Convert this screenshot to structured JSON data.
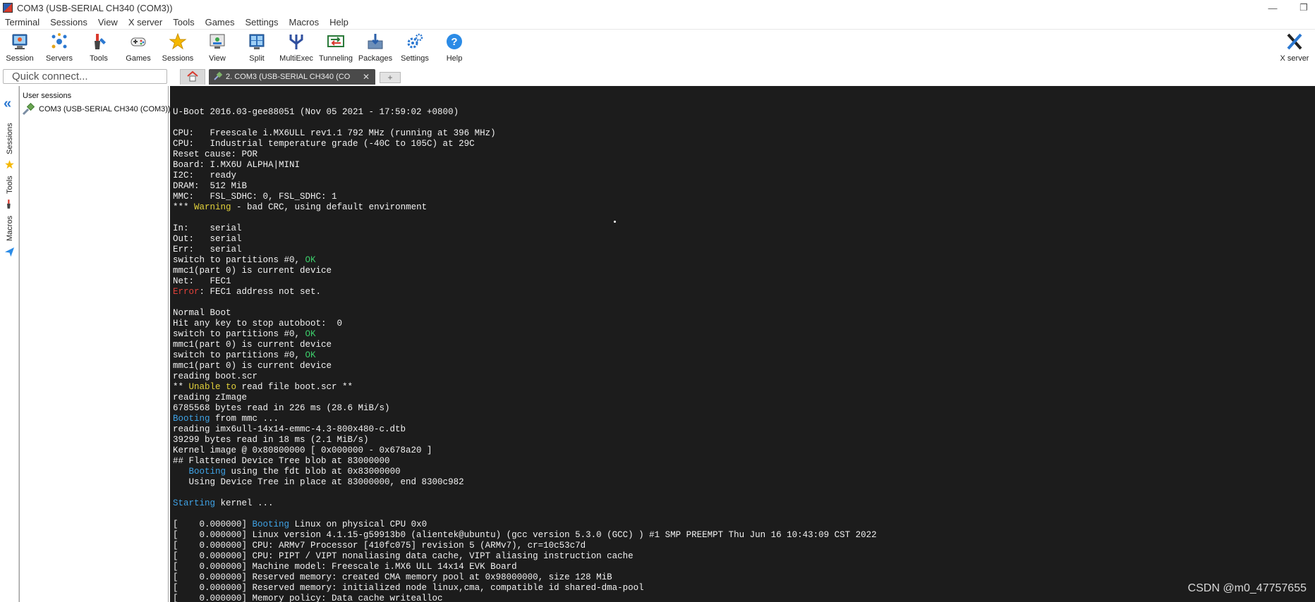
{
  "window": {
    "title": "COM3  (USB-SERIAL CH340 (COM3))",
    "minimize_glyph": "—",
    "restore_glyph": "❐"
  },
  "menu": [
    "Terminal",
    "Sessions",
    "View",
    "X server",
    "Tools",
    "Games",
    "Settings",
    "Macros",
    "Help"
  ],
  "toolbar": {
    "items": [
      {
        "label": "Session",
        "icon": "session-icon"
      },
      {
        "label": "Servers",
        "icon": "servers-icon"
      },
      {
        "label": "Tools",
        "icon": "tools-icon"
      },
      {
        "label": "Games",
        "icon": "games-icon"
      },
      {
        "label": "Sessions",
        "icon": "star-icon"
      },
      {
        "label": "View",
        "icon": "view-icon"
      },
      {
        "label": "Split",
        "icon": "split-icon"
      },
      {
        "label": "MultiExec",
        "icon": "multiexec-icon"
      },
      {
        "label": "Tunneling",
        "icon": "tunneling-icon"
      },
      {
        "label": "Packages",
        "icon": "packages-icon"
      },
      {
        "label": "Settings",
        "icon": "settings-icon"
      },
      {
        "label": "Help",
        "icon": "help-icon"
      }
    ],
    "xserver_label": "X server"
  },
  "quick_connect": {
    "placeholder": "Quick connect..."
  },
  "tabs": {
    "active_label": "2. COM3  (USB-SERIAL CH340 (CO",
    "close_glyph": "✕",
    "new_tab_glyph": "+"
  },
  "side_rail": {
    "collapse_glyph": "«",
    "tabs": [
      "Sessions",
      "Tools",
      "Macros"
    ]
  },
  "sessions_panel": {
    "header": "User sessions",
    "items": [
      "COM3  (USB-SERIAL CH340 (COM3))"
    ]
  },
  "colors": {
    "terminal_bg": "#1c1c1c",
    "text": "#f2f2f2",
    "warning": "#e3d23b",
    "ok": "#3ccf6b",
    "error": "#e0413a",
    "info": "#3fa3e6",
    "accent": "#2b78d1"
  },
  "terminal": {
    "lines": [
      [
        {
          "t": "U-Boot 2016.03-gee88051 (Nov 05 2021 - 17:59:02 +0800)",
          "c": "white"
        }
      ],
      [],
      [
        {
          "t": "CPU:   Freescale i.MX6ULL rev1.1 792 MHz (running at 396 MHz)",
          "c": "white"
        }
      ],
      [
        {
          "t": "CPU:   Industrial temperature grade (-40C to 105C) at 29C",
          "c": "white"
        }
      ],
      [
        {
          "t": "Reset cause: POR",
          "c": "white"
        }
      ],
      [
        {
          "t": "Board: I.MX6U ALPHA|MINI",
          "c": "white"
        }
      ],
      [
        {
          "t": "I2C:   ready",
          "c": "white"
        }
      ],
      [
        {
          "t": "DRAM:  512 MiB",
          "c": "white"
        }
      ],
      [
        {
          "t": "MMC:   FSL_SDHC: 0, FSL_SDHC: 1",
          "c": "white"
        }
      ],
      [
        {
          "t": "*** ",
          "c": "white"
        },
        {
          "t": "Warning",
          "c": "yellow"
        },
        {
          "t": " - bad CRC, using default environment",
          "c": "white"
        }
      ],
      [],
      [
        {
          "t": "In:    serial",
          "c": "white"
        }
      ],
      [
        {
          "t": "Out:   serial",
          "c": "white"
        }
      ],
      [
        {
          "t": "Err:   serial",
          "c": "white"
        }
      ],
      [
        {
          "t": "switch to partitions #0, ",
          "c": "white"
        },
        {
          "t": "OK",
          "c": "green"
        }
      ],
      [
        {
          "t": "mmc1(part 0) is current device",
          "c": "white"
        }
      ],
      [
        {
          "t": "Net:   FEC1",
          "c": "white"
        }
      ],
      [
        {
          "t": "Error",
          "c": "red"
        },
        {
          "t": ": FEC1 address not set.",
          "c": "white"
        }
      ],
      [],
      [
        {
          "t": "Normal Boot",
          "c": "white"
        }
      ],
      [
        {
          "t": "Hit any key to stop autoboot:  0",
          "c": "white"
        }
      ],
      [
        {
          "t": "switch to partitions #0, ",
          "c": "white"
        },
        {
          "t": "OK",
          "c": "green"
        }
      ],
      [
        {
          "t": "mmc1(part 0) is current device",
          "c": "white"
        }
      ],
      [
        {
          "t": "switch to partitions #0, ",
          "c": "white"
        },
        {
          "t": "OK",
          "c": "green"
        }
      ],
      [
        {
          "t": "mmc1(part 0) is current device",
          "c": "white"
        }
      ],
      [
        {
          "t": "reading boot.scr",
          "c": "white"
        }
      ],
      [
        {
          "t": "** ",
          "c": "white"
        },
        {
          "t": "Unable to",
          "c": "yellow"
        },
        {
          "t": " read file boot.scr **",
          "c": "white"
        }
      ],
      [
        {
          "t": "reading zImage",
          "c": "white"
        }
      ],
      [
        {
          "t": "6785568 bytes read in 226 ms (28.6 MiB/s)",
          "c": "white"
        }
      ],
      [
        {
          "t": "Booting",
          "c": "cyan"
        },
        {
          "t": " from mmc ...",
          "c": "white"
        }
      ],
      [
        {
          "t": "reading imx6ull-14x14-emmc-4.3-800x480-c.dtb",
          "c": "white"
        }
      ],
      [
        {
          "t": "39299 bytes read in 18 ms (2.1 MiB/s)",
          "c": "white"
        }
      ],
      [
        {
          "t": "Kernel image @ 0x80800000 [ 0x000000 - 0x678a20 ]",
          "c": "white"
        }
      ],
      [
        {
          "t": "## Flattened Device Tree blob at 83000000",
          "c": "white"
        }
      ],
      [
        {
          "t": "   ",
          "c": "white"
        },
        {
          "t": "Booting",
          "c": "cyan"
        },
        {
          "t": " using the fdt blob at 0x83000000",
          "c": "white"
        }
      ],
      [
        {
          "t": "   Using Device Tree in place at 83000000, end 8300c982",
          "c": "white"
        }
      ],
      [],
      [
        {
          "t": "Starting",
          "c": "cyan"
        },
        {
          "t": " kernel ...",
          "c": "white"
        }
      ],
      [],
      [
        {
          "t": "[    0.000000] ",
          "c": "white"
        },
        {
          "t": "Booting",
          "c": "cyan"
        },
        {
          "t": " Linux on physical CPU 0x0",
          "c": "white"
        }
      ],
      [
        {
          "t": "[    0.000000] Linux version 4.1.15-g59913b0 (alientek@ubuntu) (gcc version 5.3.0 (GCC) ) #1 SMP PREEMPT Thu Jun 16 10:43:09 CST 2022",
          "c": "white"
        }
      ],
      [
        {
          "t": "[    0.000000] CPU: ARMv7 Processor [410fc075] revision 5 (ARMv7), cr=10c53c7d",
          "c": "white"
        }
      ],
      [
        {
          "t": "[    0.000000] CPU: PIPT / VIPT nonaliasing data cache, VIPT aliasing instruction cache",
          "c": "white"
        }
      ],
      [
        {
          "t": "[    0.000000] Machine model: Freescale i.MX6 ULL 14x14 EVK Board",
          "c": "white"
        }
      ],
      [
        {
          "t": "[    0.000000] Reserved memory: created CMA memory pool at 0x98000000, size 128 MiB",
          "c": "white"
        }
      ],
      [
        {
          "t": "[    0.000000] Reserved memory: initialized node linux,cma, compatible id shared-dma-pool",
          "c": "white"
        }
      ],
      [
        {
          "t": "[    0.000000] Memory policy: Data cache writealloc",
          "c": "white"
        }
      ]
    ]
  },
  "watermark": "CSDN @m0_47757655"
}
